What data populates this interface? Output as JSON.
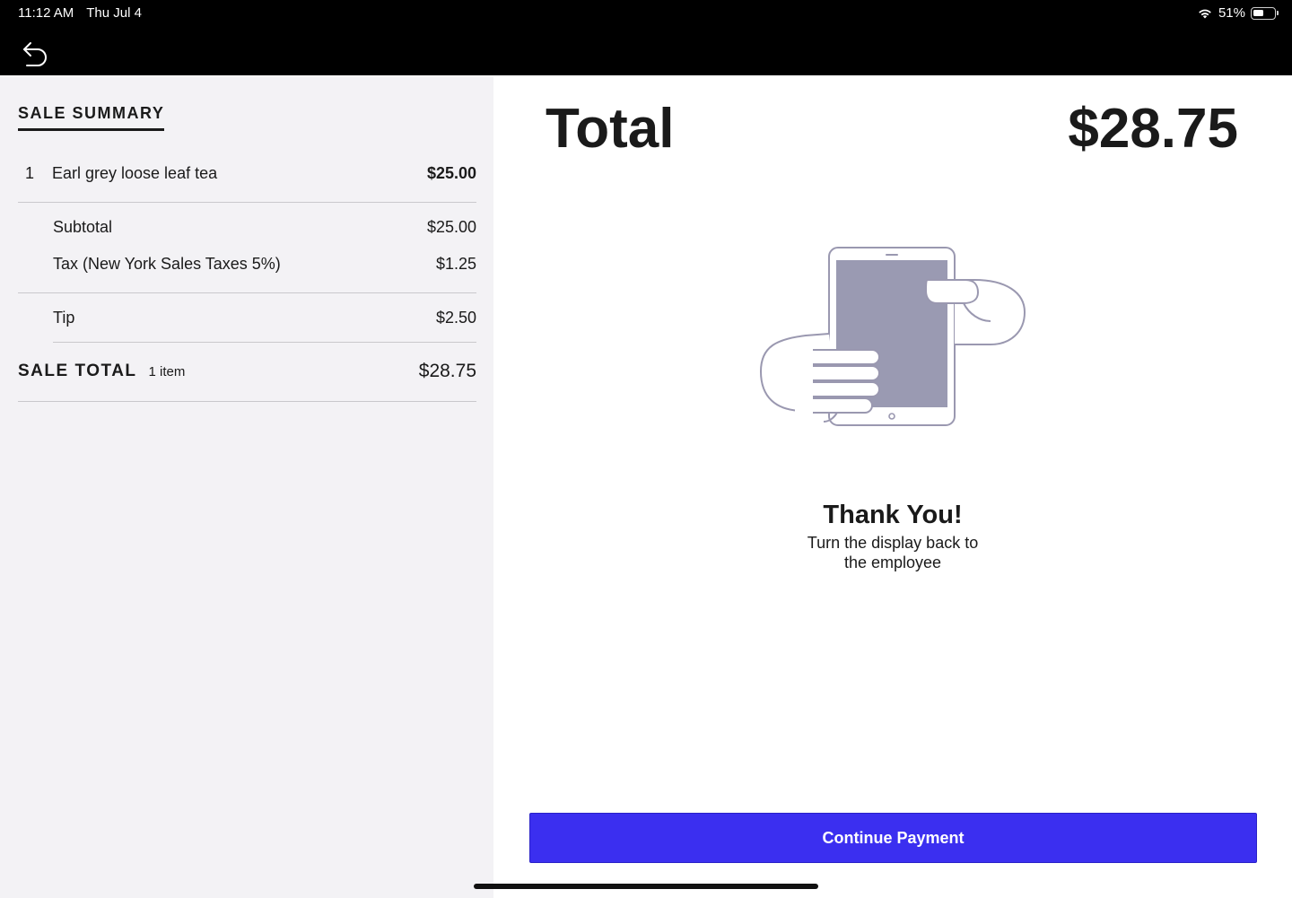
{
  "status_bar": {
    "time": "11:12 AM",
    "date": "Thu Jul 4",
    "wifi_icon": "wifi-icon",
    "battery_percent": "51%",
    "battery_level": 0.51
  },
  "nav": {
    "back_icon": "undo-arrow-icon"
  },
  "summary": {
    "title": "SALE SUMMARY",
    "items": [
      {
        "qty": "1",
        "name": "Earl grey loose leaf tea",
        "price": "$25.00"
      }
    ],
    "subtotal_label": "Subtotal",
    "subtotal_value": "$25.00",
    "tax_label": "Tax (New York Sales Taxes 5%)",
    "tax_value": "$1.25",
    "tip_label": "Tip",
    "tip_value": "$2.50",
    "sale_total_label": "SALE TOTAL",
    "sale_total_count": "1 item",
    "sale_total_value": "$28.75"
  },
  "main": {
    "total_label": "Total",
    "total_amount": "$28.75",
    "illustration_icon": "hands-holding-tablet-icon",
    "thanks_title": "Thank You!",
    "thanks_line1": "Turn the display back to",
    "thanks_line2": "the employee",
    "continue_label": "Continue Payment"
  },
  "colors": {
    "button": "#3b2ff0",
    "panel_bg": "#f3f2f5",
    "illustration_stroke": "#9a98b0",
    "illustration_screen": "#9a9ab2"
  }
}
